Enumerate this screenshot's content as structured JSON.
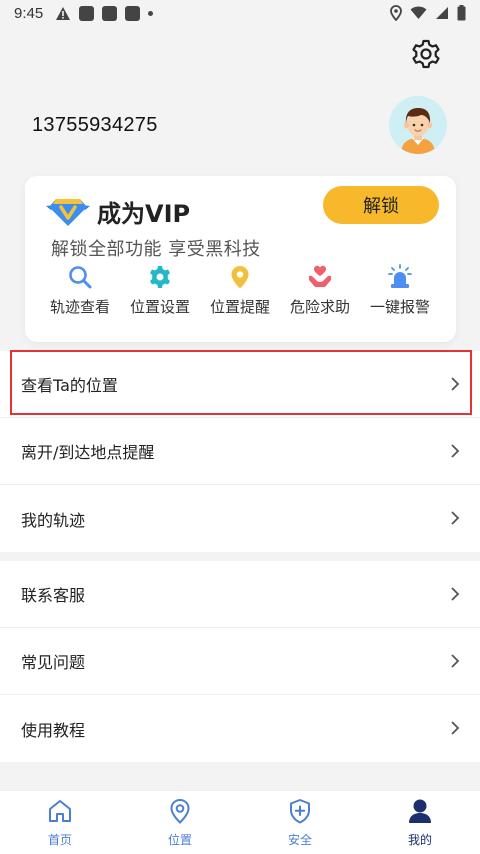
{
  "status_bar": {
    "time": "9:45"
  },
  "header": {
    "phone": "13755934275"
  },
  "vip": {
    "title": "成为VIP",
    "subtitle": "解锁全部功能 享受黑科技",
    "unlock_label": "解锁",
    "features": [
      {
        "label": "轨迹查看",
        "icon": "search-icon"
      },
      {
        "label": "位置设置",
        "icon": "gear-icon"
      },
      {
        "label": "位置提醒",
        "icon": "location-pin-icon"
      },
      {
        "label": "危险求助",
        "icon": "hand-heart-icon"
      },
      {
        "label": "一键报警",
        "icon": "alarm-icon"
      }
    ]
  },
  "menu_group_1": [
    {
      "label": "查看Ta的位置"
    },
    {
      "label": "离开/到达地点提醒"
    },
    {
      "label": "我的轨迹"
    }
  ],
  "menu_group_2": [
    {
      "label": "联系客服"
    },
    {
      "label": "常见问题"
    },
    {
      "label": "使用教程"
    }
  ],
  "tabs": [
    {
      "label": "首页",
      "icon": "home-icon"
    },
    {
      "label": "位置",
      "icon": "location-icon"
    },
    {
      "label": "安全",
      "icon": "shield-plus-icon"
    },
    {
      "label": "我的",
      "icon": "person-icon",
      "active": true
    }
  ],
  "colors": {
    "accent_yellow": "#f7b92b",
    "tab_blue": "#4a7fd4",
    "tab_active": "#1c2e6b",
    "highlight_red": "#e53232"
  }
}
